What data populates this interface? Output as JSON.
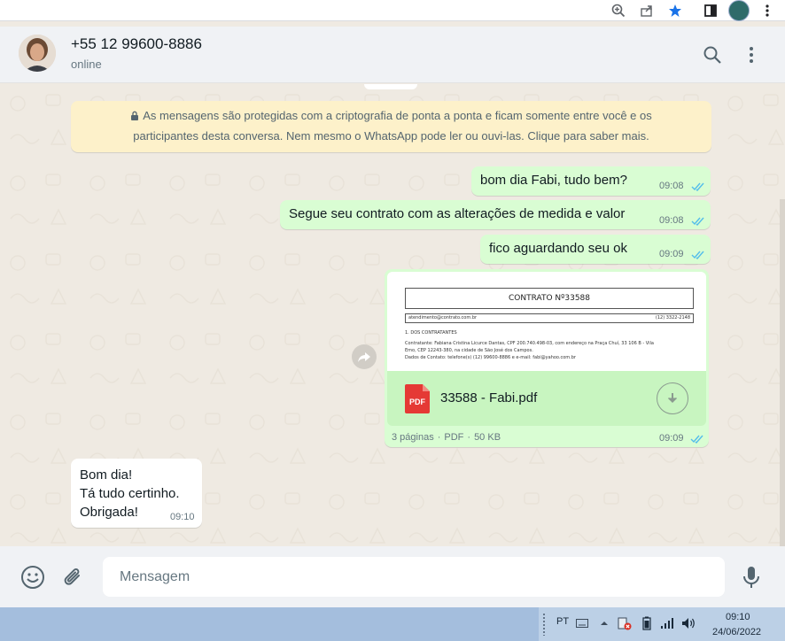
{
  "contact": {
    "name": "+55 12 99600-8886",
    "status": "online"
  },
  "encryption_notice": {
    "line1": "As mensagens são protegidas com a criptografia de ponta a ponta e ficam somente entre você e os",
    "line2": "participantes desta conversa. Nem mesmo o WhatsApp pode ler ou ouvi-las. Clique para saber mais."
  },
  "messages": [
    {
      "direction": "out",
      "text": "bom dia Fabi, tudo bem?",
      "time": "09:08",
      "status": "read"
    },
    {
      "direction": "out",
      "text": "Segue seu contrato com as alterações de medida e valor",
      "time": "09:08",
      "status": "read"
    },
    {
      "direction": "out",
      "text": "fico aguardando seu ok",
      "time": "09:09",
      "status": "read"
    },
    {
      "direction": "out",
      "type": "document",
      "time": "09:09",
      "status": "read"
    },
    {
      "direction": "in",
      "lines": [
        "Bom dia!",
        "Tá tudo certinho.",
        "Obrigada!"
      ],
      "time": "09:10"
    }
  ],
  "document": {
    "file_name": "33588 - Fabi.pdf",
    "icon_label": "PDF",
    "pages": "3 páginas",
    "type": "PDF",
    "size": "50 KB",
    "preview": {
      "heading": "CONTRATO Nº33588",
      "email": "atendimento@contrato.com.br",
      "phone": "(12) 3322-2148",
      "section": "1. DOS CONTRATANTES",
      "line1": "Contratante: Fabiana Cristina Licurce Dantas, CPF 200.740.498-03, com endereço na Praça Chuí, 33 106 B - Vila",
      "line2": "Emo, CEP 12243-380, na cidade de São José dos Campos.",
      "line3": "Dados de Contato: telefone(s) (12) 99600-8886 e e-mail: fabi@yahoo.com.br"
    }
  },
  "composer": {
    "placeholder": "Mensagem"
  },
  "taskbar": {
    "language": "PT",
    "time": "09:10",
    "date": "24/06/2022"
  },
  "colors": {
    "outgoing_bubble": "#d9fdd3",
    "incoming_bubble": "#ffffff",
    "read_ticks": "#53bdeb",
    "notice_bg": "#fdf1ca",
    "chat_bg": "#efeae2"
  },
  "icons": {
    "search": "search-icon",
    "menu": "menu-dots-icon",
    "emoji": "emoji-icon",
    "attach": "paperclip-icon",
    "mic": "microphone-icon",
    "forward": "forward-icon",
    "download": "download-icon"
  }
}
